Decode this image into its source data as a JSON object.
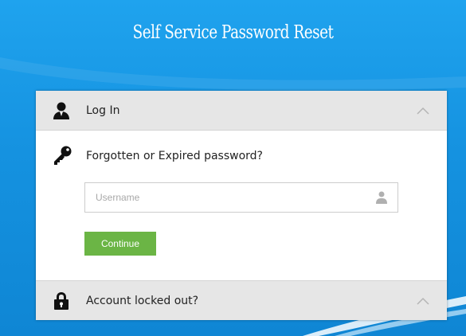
{
  "page": {
    "title": "Self Service Password Reset"
  },
  "login_section": {
    "header_label": "Log In",
    "header_icon": "user-icon",
    "chevron_icon": "chevron-up-icon",
    "forgot_icon": "key-icon",
    "forgot_text": "Forgotten or Expired password?",
    "username": {
      "value": "",
      "placeholder": "Username",
      "icon": "user-icon"
    },
    "continue_label": "Continue"
  },
  "locked_section": {
    "header_label": "Account locked out?",
    "header_icon": "lock-icon",
    "chevron_icon": "chevron-up-icon"
  },
  "colors": {
    "background": "#1b97e3",
    "button": "#6bb545",
    "header_bg": "#e6e6e6"
  }
}
